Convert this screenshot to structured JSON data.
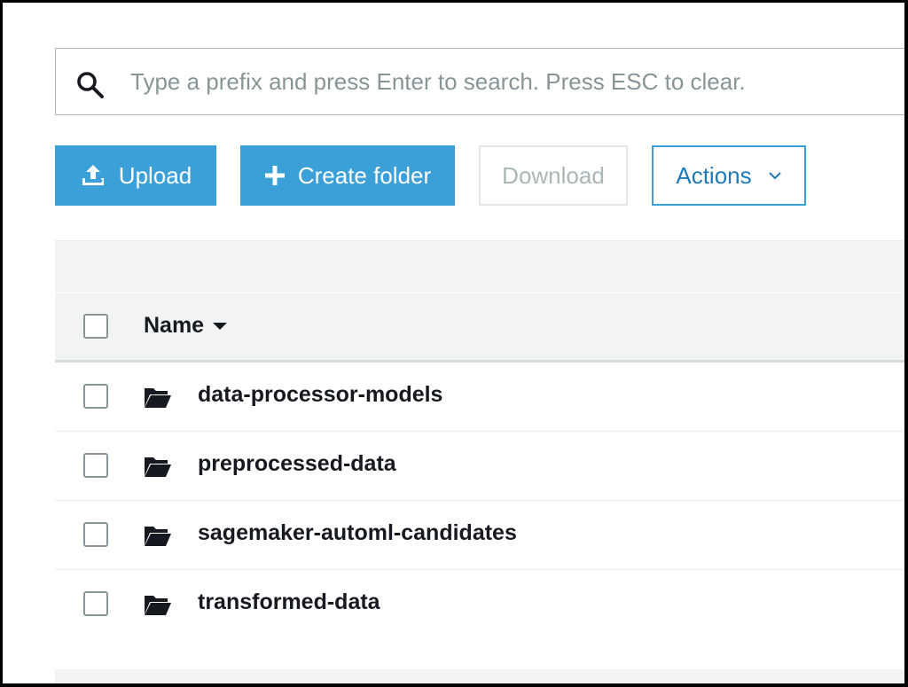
{
  "search": {
    "placeholder": "Type a prefix and press Enter to search. Press ESC to clear.",
    "value": "",
    "icon": "search-icon"
  },
  "toolbar": {
    "upload_label": "Upload",
    "create_folder_label": "Create folder",
    "download_label": "Download",
    "actions_label": "Actions"
  },
  "table": {
    "column_name": "Name",
    "rows": [
      {
        "name": "data-processor-models"
      },
      {
        "name": "preprocessed-data"
      },
      {
        "name": "sagemaker-automl-candidates"
      },
      {
        "name": "transformed-data"
      }
    ]
  },
  "colors": {
    "primary": "#3b9fd8",
    "primary_text": "#1e7ab8",
    "disabled_text": "#aab7b8",
    "band": "#f2f3f3"
  }
}
